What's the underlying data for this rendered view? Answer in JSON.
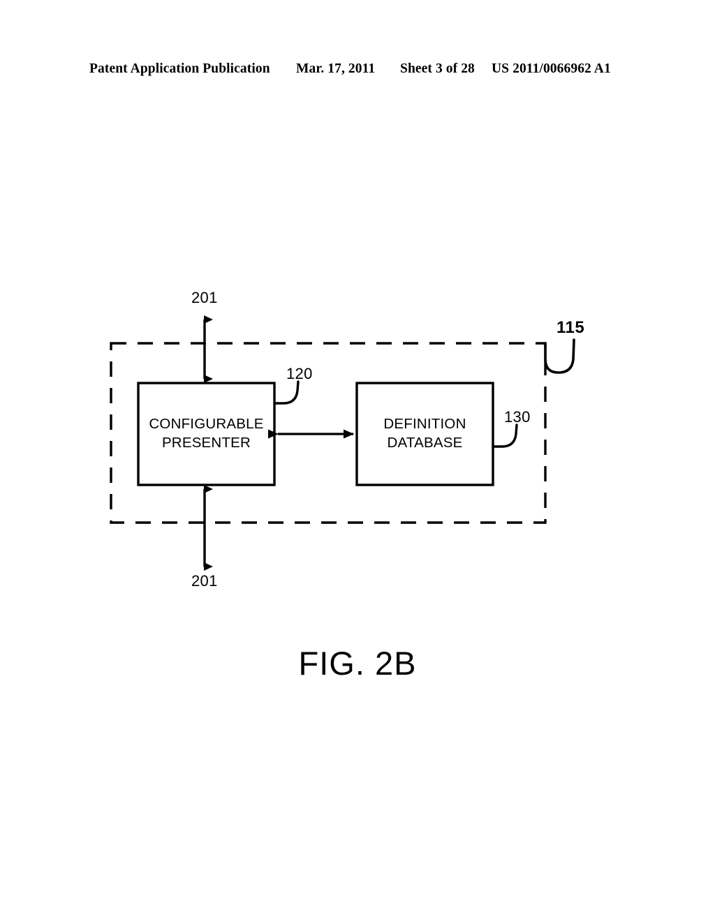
{
  "header": {
    "publication": "Patent Application Publication",
    "date": "Mar. 17, 2011",
    "sheet": "Sheet 3 of 28",
    "patent_number": "US 2011/0066962 A1"
  },
  "figure": {
    "caption": "FIG. 2B",
    "system_ref": "115",
    "boxes": [
      {
        "id": "configurable-presenter",
        "line1": "CONFIGURABLE",
        "line2": "PRESENTER",
        "ref": "120"
      },
      {
        "id": "definition-database",
        "line1": "DEFINITION",
        "line2": "DATABASE",
        "ref": "130"
      }
    ],
    "connectors": [
      {
        "id": "top-interface",
        "ref": "201",
        "direction": "bidirectional-vertical"
      },
      {
        "id": "bottom-interface",
        "ref": "201",
        "direction": "bidirectional-vertical"
      },
      {
        "id": "presenter-database-link",
        "ref": "",
        "direction": "bidirectional-horizontal"
      }
    ],
    "colors": {
      "ink": "#000000",
      "background": "#ffffff"
    }
  }
}
